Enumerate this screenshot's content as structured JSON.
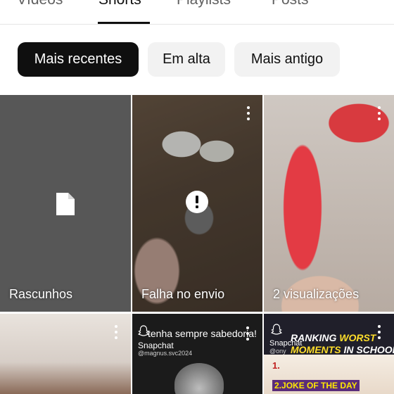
{
  "tabs": [
    {
      "label": "Vídeos",
      "active": false
    },
    {
      "label": "Shorts",
      "active": true
    },
    {
      "label": "Playlists",
      "active": false
    },
    {
      "label": "Posts",
      "active": false
    }
  ],
  "chips": [
    {
      "label": "Mais recentes",
      "selected": true
    },
    {
      "label": "Em alta",
      "selected": false
    },
    {
      "label": "Mais antigo",
      "selected": false
    }
  ],
  "grid": {
    "tile1": {
      "label": "Rascunhos",
      "icon": "document-icon"
    },
    "tile2": {
      "label": "Falha no envio",
      "icon": "alert-icon",
      "menu_icon": "more-vert-icon"
    },
    "tile3": {
      "label": "2 visualizações",
      "menu_icon": "more-vert-icon"
    },
    "tile4": {
      "menu_icon": "more-vert-icon"
    },
    "tile5": {
      "caption": "tenha sempre sabedoria!",
      "app": "Snapchat",
      "handle": "@magnus.svc2024",
      "menu_icon": "more-vert-icon"
    },
    "tile6": {
      "app": "Snapchat",
      "handle": "@ony",
      "title_a": "RANKING ",
      "title_b": "WORST",
      "sub_a": "MOMENTS",
      "sub_b": " IN SCHOOL",
      "item1": "1.",
      "item2": "2.",
      "joke": "JOKE OF THE DAY",
      "menu_icon": "more-vert-icon"
    }
  },
  "colors": {
    "accent": "#0f0f0f",
    "chip_bg": "#f2f2f2",
    "highlight": "#ffde2b"
  }
}
